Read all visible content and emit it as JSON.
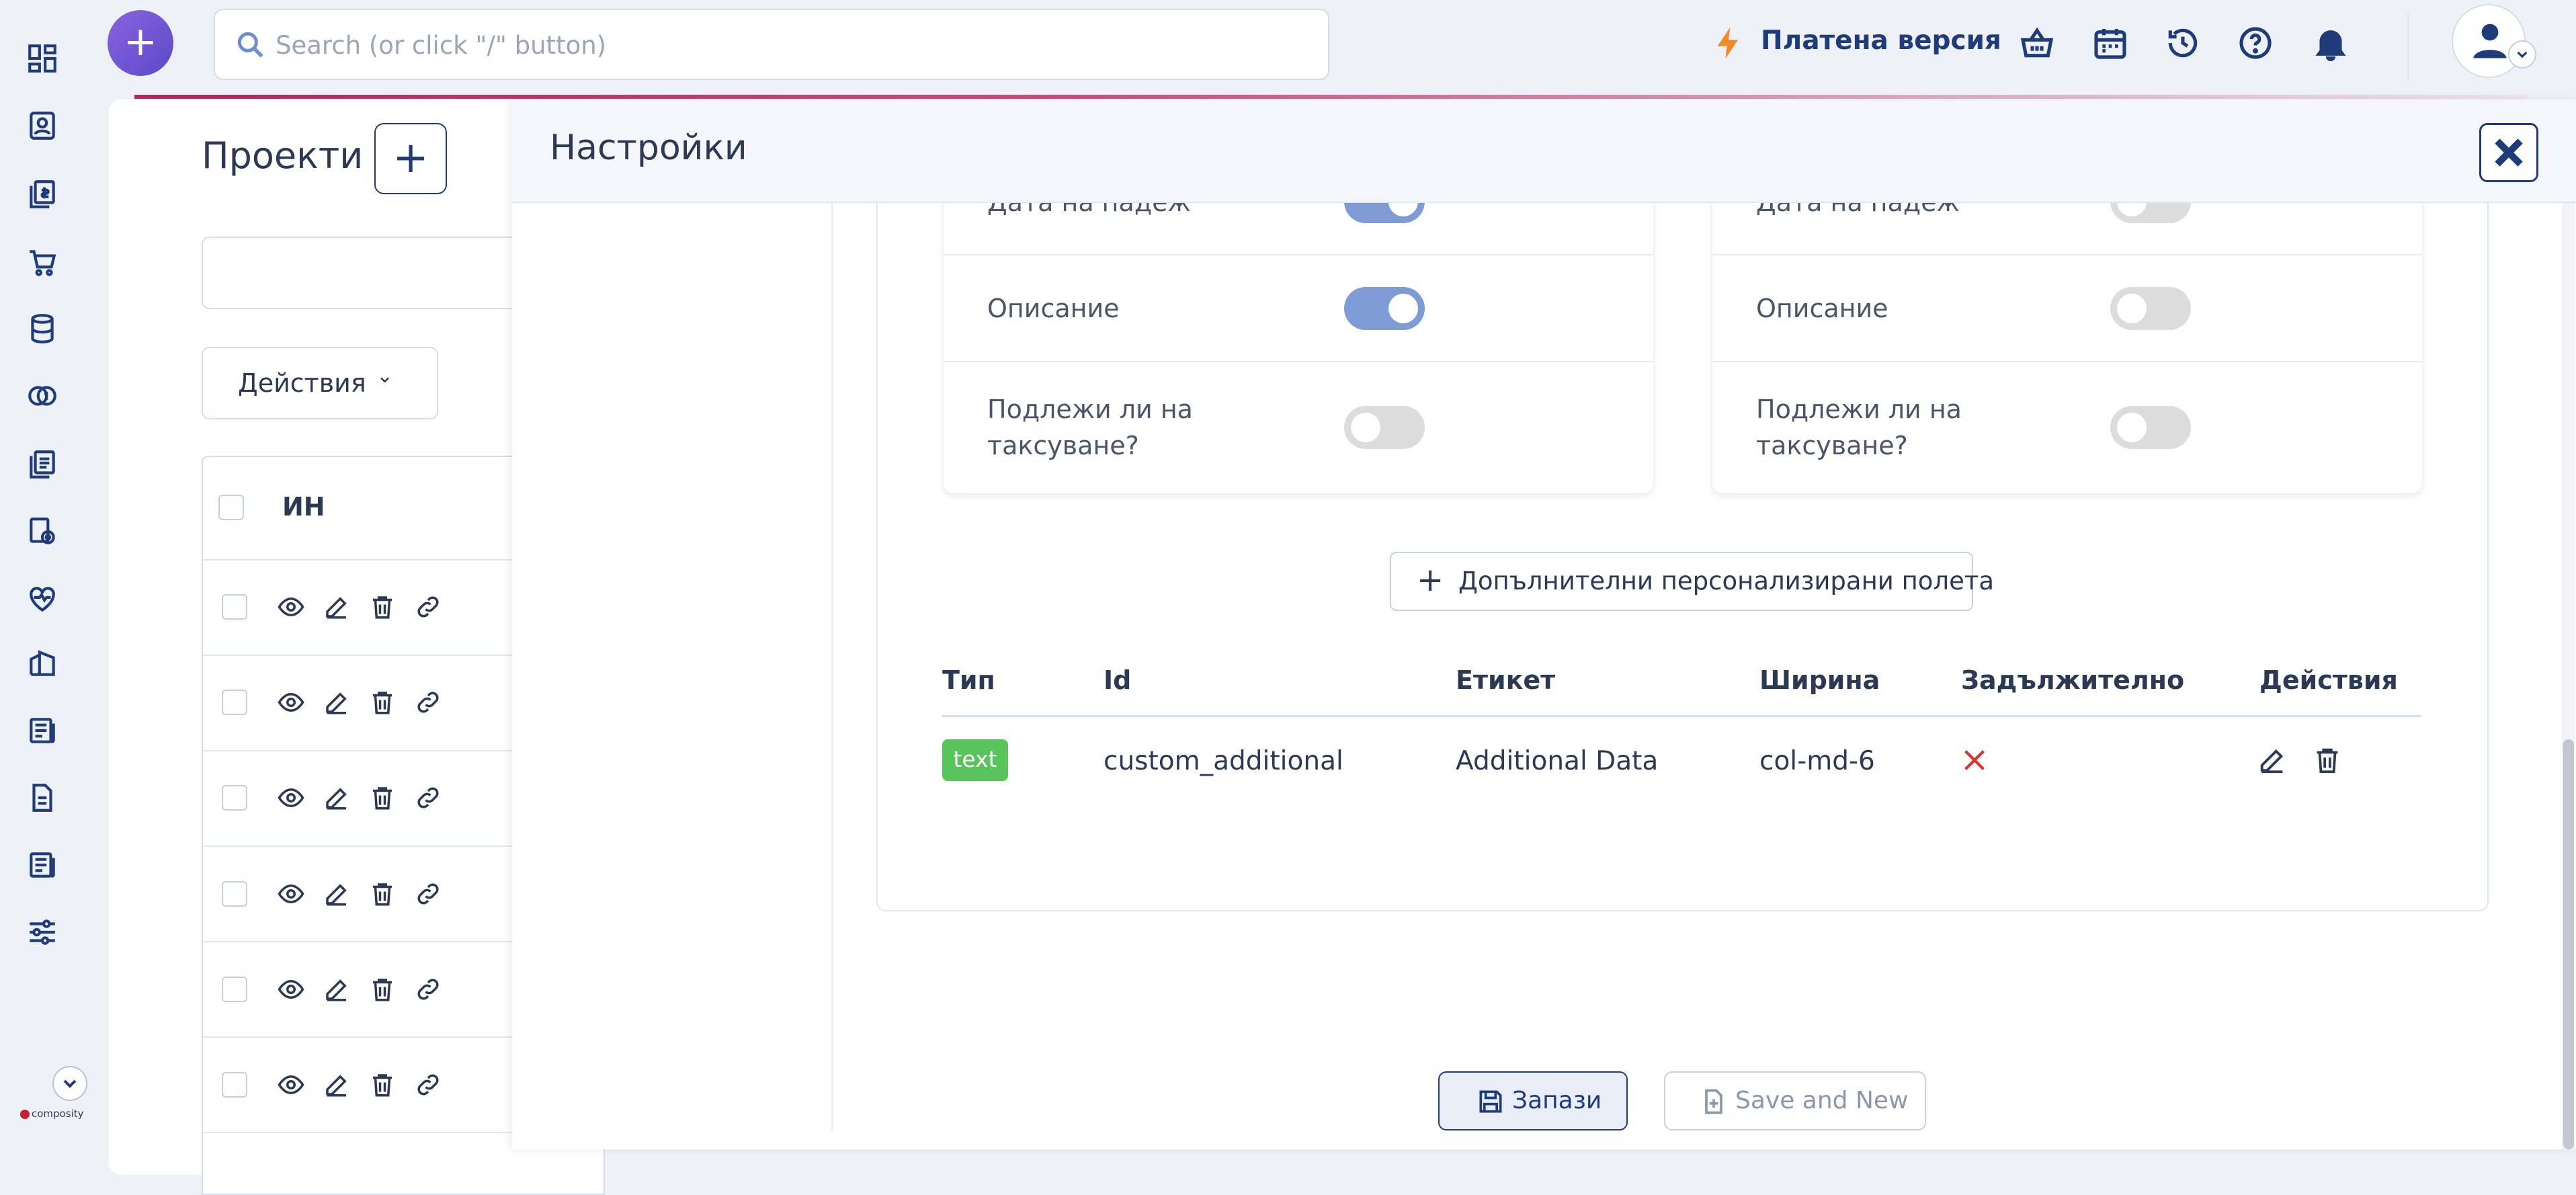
{
  "header": {
    "search_placeholder": "Search (or click \"/\" button)",
    "paid_version": "Платена версия"
  },
  "projects": {
    "title": "Проекти",
    "actions_label": "Действия",
    "column_in": "ИН",
    "row_count": 6
  },
  "modal": {
    "title": "Настройки",
    "left_fields": [
      {
        "label": "Дата на падеж",
        "enabled": true
      },
      {
        "label": "Описание",
        "enabled": true
      },
      {
        "label": "Подлежи ли на таксуване?",
        "enabled": false
      }
    ],
    "right_fields": [
      {
        "label": "Дата на падеж",
        "enabled": false
      },
      {
        "label": "Описание",
        "enabled": false
      },
      {
        "label": "Подлежи ли на таксуване?",
        "enabled": false
      }
    ],
    "add_custom_fields": "Допълнителни персонализирани полета",
    "custom_table": {
      "headers": [
        "Тип",
        "Id",
        "Етикет",
        "Ширина",
        "Задължително",
        "Действия"
      ],
      "rows": [
        {
          "type": "text",
          "id": "custom_additional",
          "label": "Additional Data",
          "width": "col-md-6",
          "required": false
        }
      ]
    },
    "save_label": "Запази",
    "save_new_label": "Save and New"
  },
  "branding": {
    "logo_text": "composity"
  },
  "colors": {
    "accent": "#1f3b78",
    "toggle_on": "#7f9bd6",
    "badge": "#59c45c",
    "required_no": "#d9342b",
    "paid_icon": "#f08a24"
  }
}
